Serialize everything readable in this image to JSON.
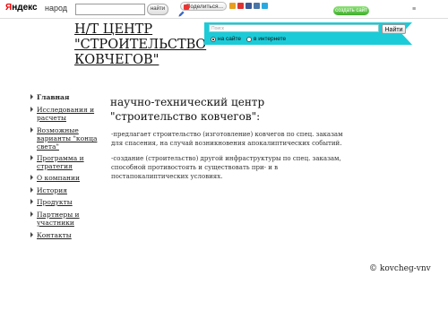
{
  "toolbar": {
    "logo_y": "Я",
    "logo_rest": "ндекс",
    "narod_label": "народ",
    "search_button": "найти",
    "share_label": "Поделиться...",
    "create_site_label": "создать сайт",
    "top_note": "≡"
  },
  "site": {
    "title": "Н/Т ЦЕНТР \"СТРОИТЕЛЬСТВО КОВЧЕГОВ\""
  },
  "site_search": {
    "placeholder": "Поиск",
    "button": "Найти",
    "option_site": "на сайте",
    "option_internet": "в интернете"
  },
  "nav": {
    "items": [
      {
        "label": "Главная"
      },
      {
        "label": "Исследования и расчеты"
      },
      {
        "label": "Возможные варианты \"конца света\""
      },
      {
        "label": "Программа и стратегия"
      },
      {
        "label": "О компании"
      },
      {
        "label": "История"
      },
      {
        "label": "Продукты"
      },
      {
        "label": "Партнеры и участники"
      },
      {
        "label": "Контакты"
      }
    ]
  },
  "content": {
    "heading": "научно-технический центр \"строительство ковчегов\":",
    "para1": "-предлагает строительство (изготовление) ковчегов по спец. заказам для спасения, на случай возникновения апокалиптических событий.",
    "para2": "-создание (строительство) другой инфраструктуры по спец. заказам, способной противостоять и существовать при- и в постапокалиптических условиях."
  },
  "footer": {
    "copyright": "© kovcheg-vnv"
  },
  "colors": {
    "panel": "#1ccbd8",
    "create_button": "#3fae2b",
    "logo_red": "#e00000"
  }
}
